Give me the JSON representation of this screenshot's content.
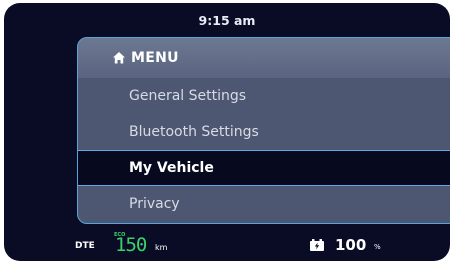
{
  "status": {
    "time": "9:15 am"
  },
  "menu": {
    "title": "MENU",
    "title_icon": "home-icon",
    "items": [
      {
        "label": "General Settings",
        "active": false
      },
      {
        "label": "Bluetooth Settings",
        "active": false
      },
      {
        "label": "My Vehicle",
        "active": true
      },
      {
        "label": "Privacy",
        "active": false
      }
    ]
  },
  "footer": {
    "dte_label": "DTE",
    "mode": "ECO",
    "range": "150",
    "range_unit": "km",
    "battery_icon": "battery-icon",
    "battery_percent": "100",
    "battery_unit": "%"
  },
  "colors": {
    "background": "#0a0c26",
    "accent": "#56a4dc",
    "eco_green": "#39d16a"
  }
}
